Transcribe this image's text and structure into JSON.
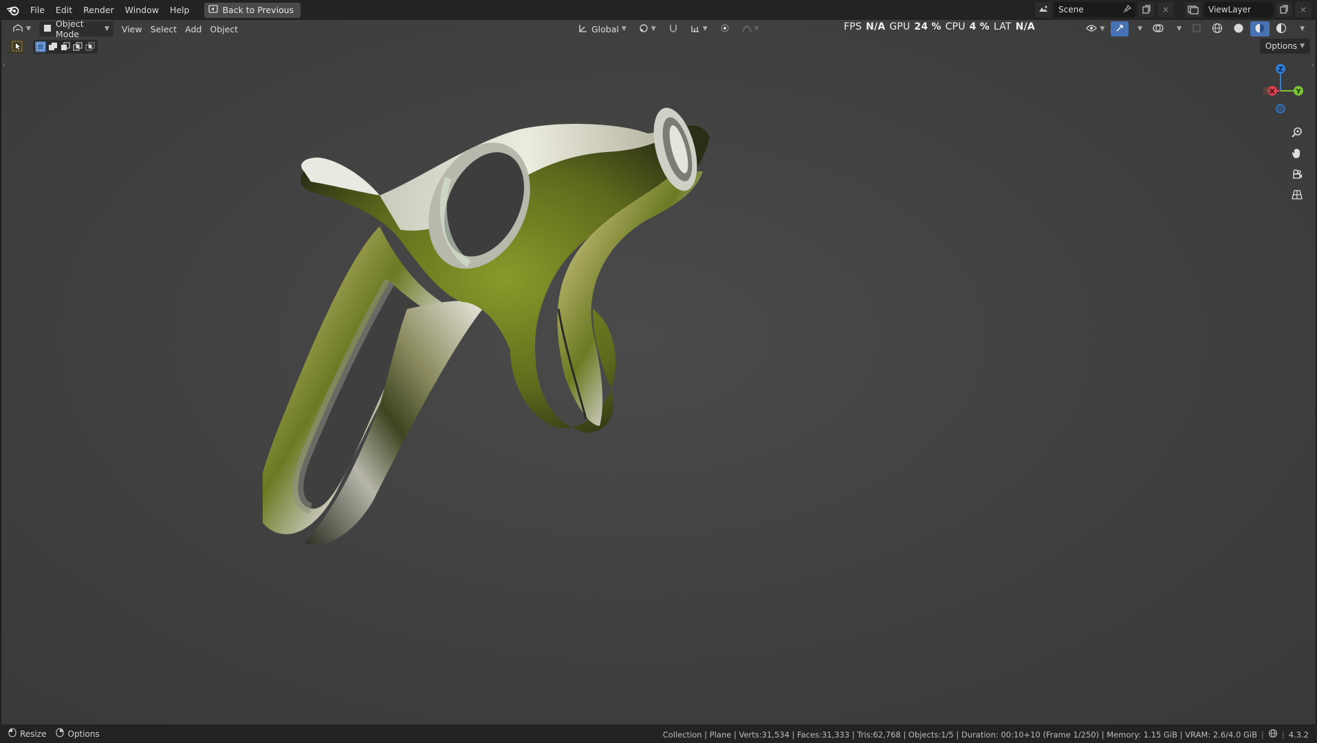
{
  "menu": {
    "items": [
      "File",
      "Edit",
      "Render",
      "Window",
      "Help"
    ],
    "back_label": "Back to Previous"
  },
  "workspace": {
    "scene_label": "Scene",
    "viewlayer_label": "ViewLayer"
  },
  "viewport_header": {
    "mode_label": "Object Mode",
    "menus": [
      "View",
      "Select",
      "Add",
      "Object"
    ],
    "transform_orientation": "Global",
    "options_label": "Options"
  },
  "hud": {
    "fps_label": "FPS",
    "fps_value": "N/A",
    "gpu_label": "GPU",
    "gpu_value": "24 %",
    "cpu_label": "CPU",
    "cpu_value": "4 %",
    "lat_label": "LAT",
    "lat_value": "N/A"
  },
  "gizmo": {
    "x": "X",
    "y": "Y",
    "z": "Z"
  },
  "statusbar": {
    "resize_label": "Resize",
    "options_label": "Options",
    "info": "Collection | Plane | Verts:31,534 | Faces:31,333 | Tris:62,768 | Objects:1/5 | Duration: 00:10+10 (Frame 1/250) | Memory: 1.15 GiB | VRAM: 2.6/4.0 GiB",
    "version": "4.3.2"
  },
  "colors": {
    "x_axis": "#e0404f",
    "y_axis": "#7cc634",
    "z_axis": "#2f7fd8",
    "accent": "#4772b3"
  }
}
